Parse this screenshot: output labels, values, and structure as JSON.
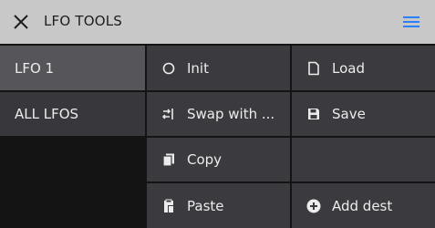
{
  "header": {
    "title": "LFO TOOLS",
    "close_icon": "close-icon",
    "menu_icon": "hamburger-menu-icon",
    "accent_color": "#2d7ff9"
  },
  "sidebar": {
    "items": [
      {
        "label": "LFO 1",
        "selected": true
      },
      {
        "label": "ALL LFOS",
        "selected": false
      }
    ]
  },
  "actions": {
    "init": {
      "label": "Init",
      "icon": "circle-icon"
    },
    "load": {
      "label": "Load",
      "icon": "file-icon"
    },
    "swap": {
      "label": "Swap with ...",
      "icon": "swap-icon"
    },
    "save": {
      "label": "Save",
      "icon": "floppy-disk-icon"
    },
    "copy": {
      "label": "Copy",
      "icon": "copy-icon"
    },
    "paste": {
      "label": "Paste",
      "icon": "clipboard-icon"
    },
    "add_dest": {
      "label": "Add dest",
      "icon": "plus-circle-icon"
    }
  }
}
